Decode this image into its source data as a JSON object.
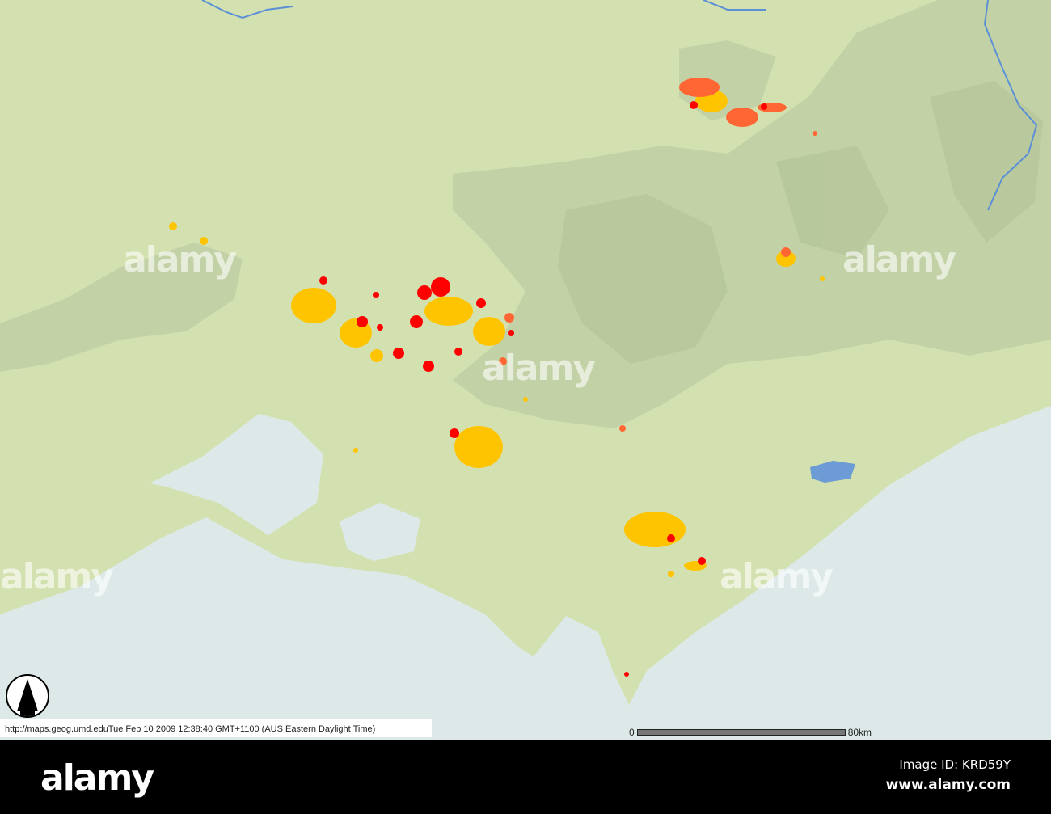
{
  "map": {
    "credit": "http://maps.geog.umd.eduTue Feb 10 2009 12:38:40 GMT+1100 (AUS Eastern Daylight Time)",
    "scale": {
      "start_label": "0",
      "end_label": "80km"
    },
    "colors": {
      "land": "#d3e1b0",
      "sea": "#dde9e8",
      "hills": "#c2d0a5",
      "river": "#5b8fd6",
      "lake": "#6c9bd5",
      "fire_new": "#ff0000",
      "fire_recent": "#ff6633",
      "fire_old": "#ffc400"
    }
  },
  "watermark": {
    "text": "alamy"
  },
  "footer": {
    "logo": "alamy",
    "image_id": "Image ID: KRD59Y",
    "site": "www.alamy.com"
  }
}
